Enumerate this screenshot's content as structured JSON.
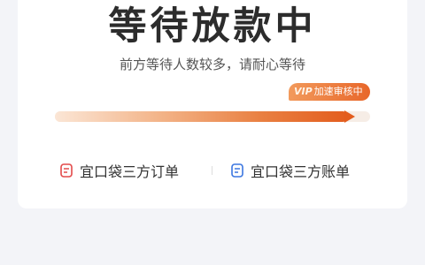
{
  "status": {
    "title": "等待放款中",
    "subtitle": "前方等待人数较多，请耐心等待"
  },
  "progress": {
    "fraction": 0.93,
    "badge_vip": "VIP",
    "badge_label": "加速审核中",
    "accent_color": "#e8672a"
  },
  "links": {
    "order_label": "宜口袋三方订单",
    "bill_label": "宜口袋三方账单",
    "order_icon": "document-icon",
    "order_icon_color": "#e34a4a",
    "bill_icon": "document-icon",
    "bill_icon_color": "#3b76e0"
  }
}
